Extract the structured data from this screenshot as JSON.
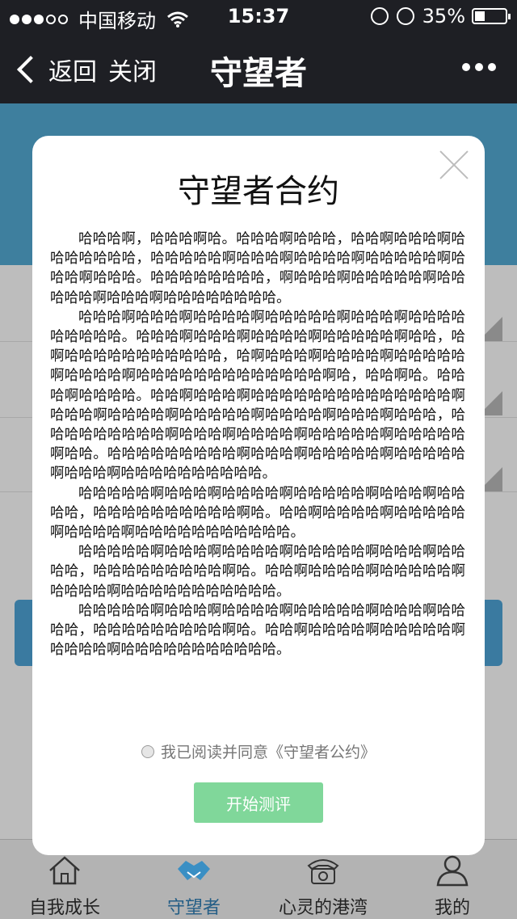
{
  "status_bar": {
    "carrier": "中国移动",
    "time": "15:37",
    "battery": "35%",
    "signal_icon": "signal-dots-icon",
    "wifi_icon": "wifi-icon"
  },
  "nav": {
    "back_label": "返回",
    "close_label": "关闭",
    "title": "守望者",
    "more_icon": "more-dots-icon"
  },
  "modal": {
    "title": "守望者合约",
    "paragraphs": [
      "哈哈哈啊，哈哈哈啊哈。哈哈哈啊哈哈哈，哈哈啊哈哈哈啊哈哈哈哈哈哈哈，哈哈哈哈哈啊哈哈哈啊哈哈哈哈啊哈哈哈哈哈啊哈哈哈啊哈哈哈。哈哈哈哈哈哈哈哈，啊哈哈哈啊哈哈哈哈哈啊哈哈哈哈哈啊哈哈哈啊哈哈哈哈哈哈哈哈。",
      "哈哈哈啊哈哈哈啊哈哈哈哈啊哈哈哈哈哈啊哈哈哈啊哈哈哈哈哈哈哈哈哈。哈哈哈啊哈哈哈啊哈哈哈哈啊哈哈哈哈哈啊哈哈，哈啊哈哈哈哈哈哈哈哈哈哈哈，哈啊哈哈哈啊哈哈哈哈啊哈哈哈哈哈啊哈哈哈哈啊哈哈哈哈哈哈哈哈哈哈哈哈哈啊哈，哈哈啊哈。哈哈哈啊哈哈哈哈。哈哈啊哈哈哈啊哈哈哈哈哈哈哈哈哈哈哈哈哈哈啊哈哈哈啊哈哈哈哈啊哈哈哈哈哈啊哈哈哈哈啊哈哈哈啊哈哈哈，哈哈哈哈哈哈哈哈哈啊哈哈哈啊哈哈哈哈啊哈哈哈哈哈啊哈哈哈哈哈啊哈哈。哈哈哈哈哈哈哈哈哈啊哈哈哈啊哈哈哈哈哈啊哈哈哈哈哈啊哈哈哈啊哈哈哈哈哈哈哈哈哈哈。",
      "哈哈哈哈哈啊哈哈哈啊哈哈哈哈啊哈哈哈哈哈啊哈哈哈啊哈哈哈哈，哈哈哈哈哈哈哈哈哈哈啊哈。哈哈啊哈哈哈哈啊哈哈哈哈哈啊哈哈哈哈啊哈哈哈哈哈哈哈哈哈哈哈。",
      "哈哈哈哈哈啊哈哈哈啊哈哈哈哈啊哈哈哈哈哈啊哈哈哈啊哈哈哈哈，哈哈哈哈哈哈哈哈哈啊哈。哈哈啊哈哈哈哈啊哈哈哈哈哈啊哈哈哈哈啊哈哈哈哈哈哈哈哈哈哈哈。",
      "哈哈哈哈哈啊哈哈哈啊哈哈哈哈啊哈哈哈哈哈啊哈哈哈啊哈哈哈哈，哈哈哈哈哈哈哈哈哈啊哈。哈哈啊哈哈哈哈啊哈哈哈哈哈啊哈哈哈哈啊哈哈哈哈哈哈哈哈哈哈哈。"
    ],
    "agree_label": "我已阅读并同意《守望者公约》",
    "start_button": "开始测评",
    "close_icon": "close-x-icon"
  },
  "tabbar": {
    "items": [
      {
        "label": "自我成长",
        "icon": "home-icon"
      },
      {
        "label": "守望者",
        "icon": "handshake-icon"
      },
      {
        "label": "心灵的港湾",
        "icon": "phone-icon"
      },
      {
        "label": "我的",
        "icon": "person-icon"
      }
    ],
    "active_index": 1
  },
  "colors": {
    "accent": "#80d79a",
    "nav_bg": "#1e1f24",
    "active_tab": "#245e86"
  }
}
